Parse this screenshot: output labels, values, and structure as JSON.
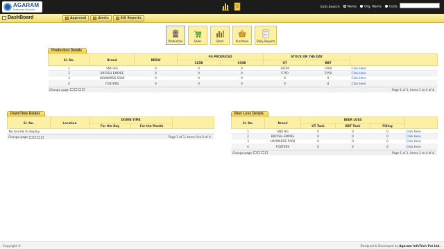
{
  "header": {
    "logo_name": "AGARAM",
    "logo_sub": "Enterprise Solutions",
    "search_label": "Extn.Search",
    "radios": [
      "Name",
      "Org. Name",
      "Code"
    ],
    "search_placeholder": ""
  },
  "nav": {
    "title": "DashBoard",
    "buttons": [
      "Approval",
      "Alerts",
      "EIS Reports"
    ]
  },
  "tiles": [
    "Production",
    "Sales",
    "Stock",
    "Purchase",
    "Daily Reports"
  ],
  "production": {
    "title": "Production Details",
    "headers": {
      "sl": "Sl. No.",
      "brand": "Brand",
      "brew": "BREW",
      "fg": "FG PRODUCED",
      "fg_325": "325B",
      "fg_650": "650B",
      "stock": "STOCK ON THE DAY",
      "ut": "UT",
      "bbt": "BBT"
    },
    "rows": [
      {
        "sl": "1",
        "brand": "SNU HG",
        "brew": "0",
        "b325": "0",
        "b650": "0",
        "ut": "10200",
        "bbt": "1000",
        "link": "Click Here"
      },
      {
        "sl": "2",
        "brand": "BRITISH EMPIRE",
        "brew": "0",
        "b325": "0",
        "b650": "0",
        "ut": "5750",
        "bbt": "2550",
        "link": "Click Here"
      },
      {
        "sl": "3",
        "brand": "HAYWARDS 5000",
        "brew": "0",
        "b325": "0",
        "b650": "0",
        "ut": "0",
        "bbt": "0",
        "link": "Click Here"
      },
      {
        "sl": "4",
        "brand": "FOSTERS",
        "brew": "0",
        "b325": "0",
        "b650": "0",
        "ut": "0",
        "bbt": "0",
        "link": "Click Here"
      }
    ],
    "pager_label": "Change page:",
    "pager_info": "Page 1 of 1, items 1 to 4 of 4."
  },
  "downtime": {
    "title": "DownTime Details",
    "headers": {
      "sl": "Sl. No.",
      "location": "Location",
      "down": "DOWN TIME",
      "day": "For the Day",
      "month": "For the Month"
    },
    "no_records": "No records to display.",
    "pager_label": "Change page:",
    "pager_info": "Page 1 of 1, items 0 to 0 of 0."
  },
  "beerloss": {
    "title": "Beer Loss Details",
    "headers": {
      "sl": "Sl. No.",
      "brand": "Brand",
      "loss": "BEER LOSS",
      "ut": "UT Tank",
      "bbt": "BBT Tank",
      "fill": "Filling"
    },
    "rows": [
      {
        "sl": "1",
        "brand": "SNU HG",
        "ut": "0",
        "bbt": "0",
        "fill": "0",
        "link": "Click Here"
      },
      {
        "sl": "2",
        "brand": "BRITISH EMPIRE",
        "ut": "0",
        "bbt": "0",
        "fill": "0",
        "link": "Click Here"
      },
      {
        "sl": "3",
        "brand": "HAYWARDS 5000",
        "ut": "0",
        "bbt": "0",
        "fill": "0",
        "link": "Click Here"
      },
      {
        "sl": "4",
        "brand": "FOSTERS",
        "ut": "0",
        "bbt": "0",
        "fill": "0",
        "link": "Click Here"
      }
    ],
    "pager_label": "Change page:",
    "pager_info": "Page 1 of 1, items 1 to 4 of 4."
  },
  "footer": {
    "copyright": "Copyright ©",
    "credit": "Designed & Developed by",
    "company": "Agaram InfoTech Pvt Ltd."
  }
}
